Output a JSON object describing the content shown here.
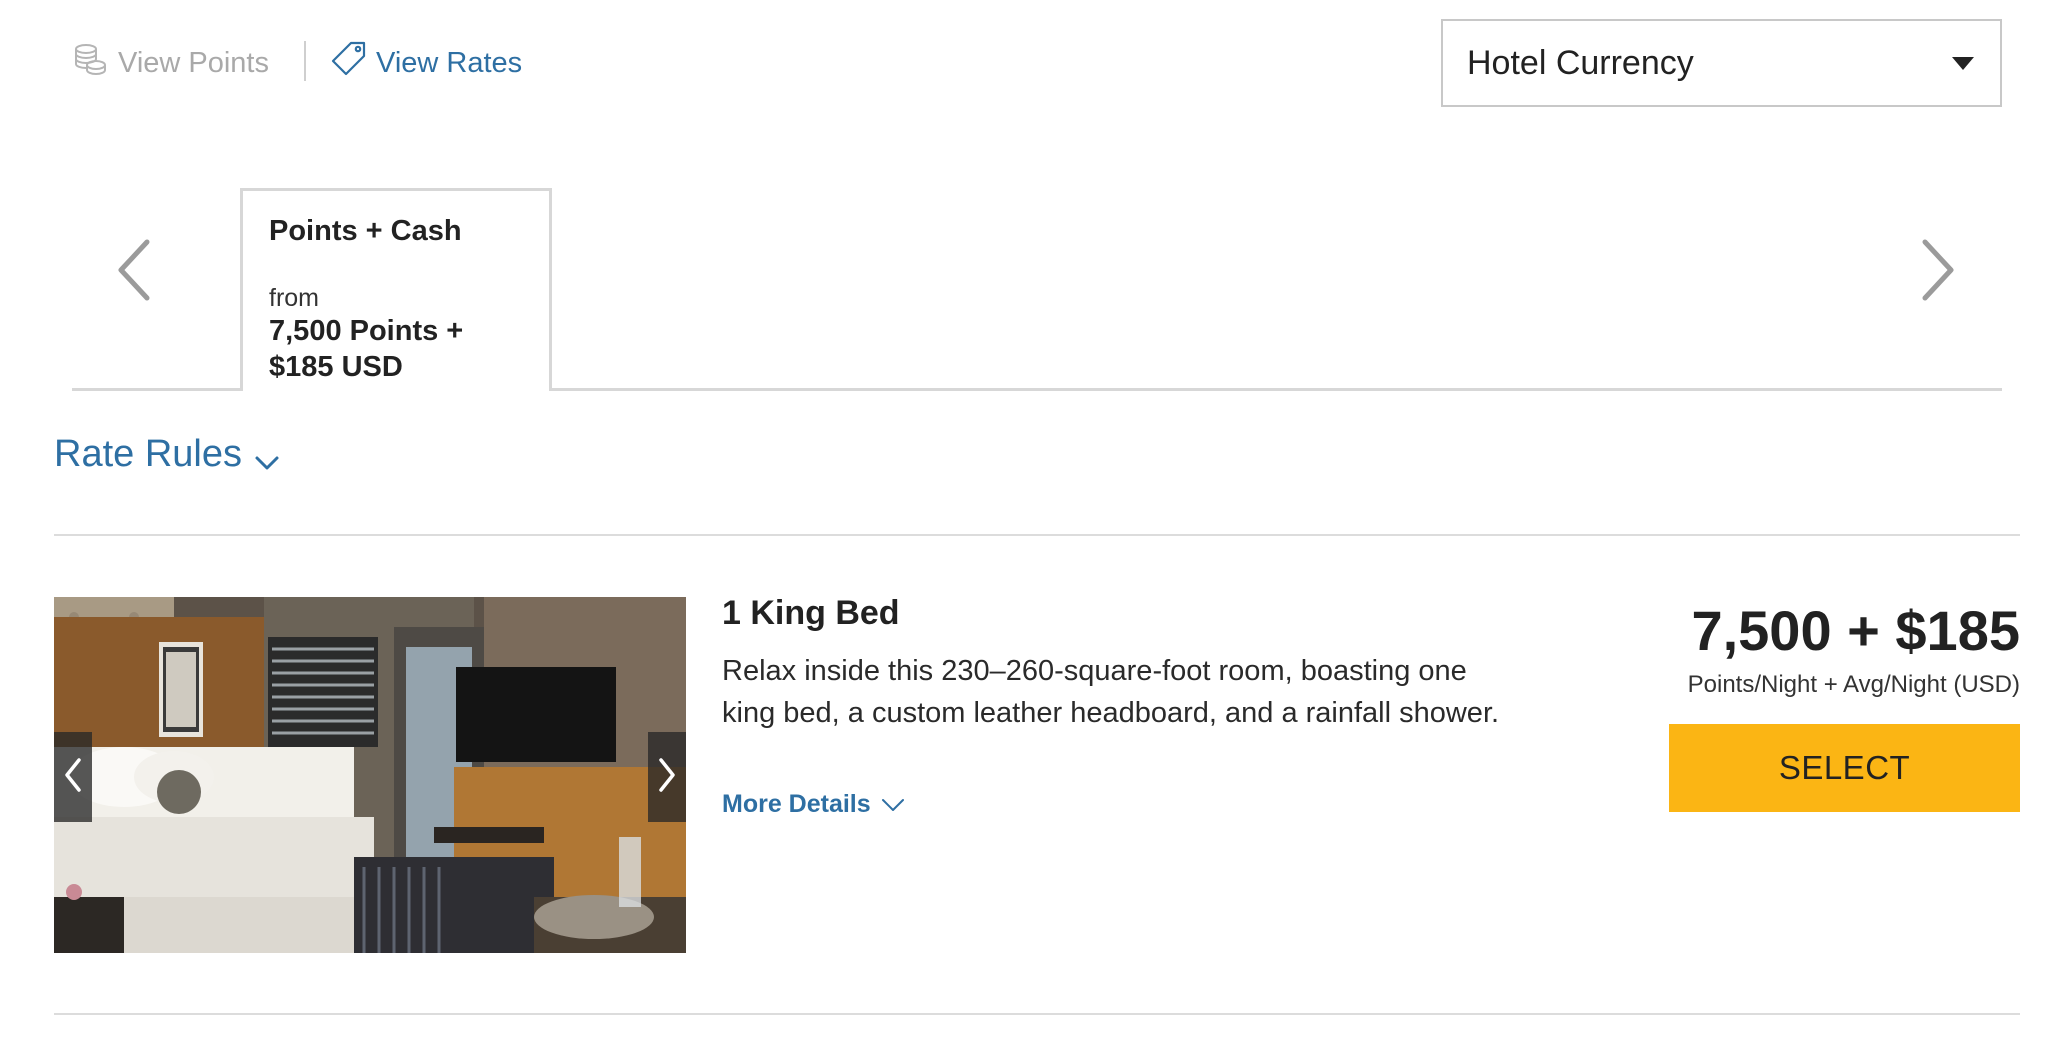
{
  "toggle": {
    "view_points_label": "View Points",
    "view_rates_label": "View Rates",
    "active": "View Rates"
  },
  "currency_select": {
    "value": "Hotel Currency"
  },
  "rate_tabs": [
    {
      "title": "Points + Cash",
      "from_label": "from",
      "price": "7,500 Points + $185 USD"
    }
  ],
  "rate_rules": {
    "label": "Rate Rules"
  },
  "room": {
    "title": "1 King Bed",
    "description": "Relax inside this 230–260-square-foot room, boasting one king bed, a custom leather headboard, and a rainfall shower.",
    "more_details_label": "More Details",
    "price": "7,500 + $185",
    "price_caption": "Points/Night + Avg/Night (USD)",
    "select_label": "SELECT"
  },
  "colors": {
    "link_blue": "#2e6fa3",
    "select_yellow": "#fbb514",
    "muted_gray": "#a9a9a9",
    "divider_gray": "#d7d7d7"
  },
  "icons": {
    "view_points": "coins-stack-icon",
    "view_rates": "price-tag-icon",
    "dropdown": "caret-down-icon",
    "tabs_prev": "chevron-left-icon",
    "tabs_next": "chevron-right-icon",
    "rate_rules": "chevron-down-icon",
    "image_prev": "chevron-left-icon",
    "image_next": "chevron-right-icon",
    "more_details": "chevron-down-icon"
  }
}
